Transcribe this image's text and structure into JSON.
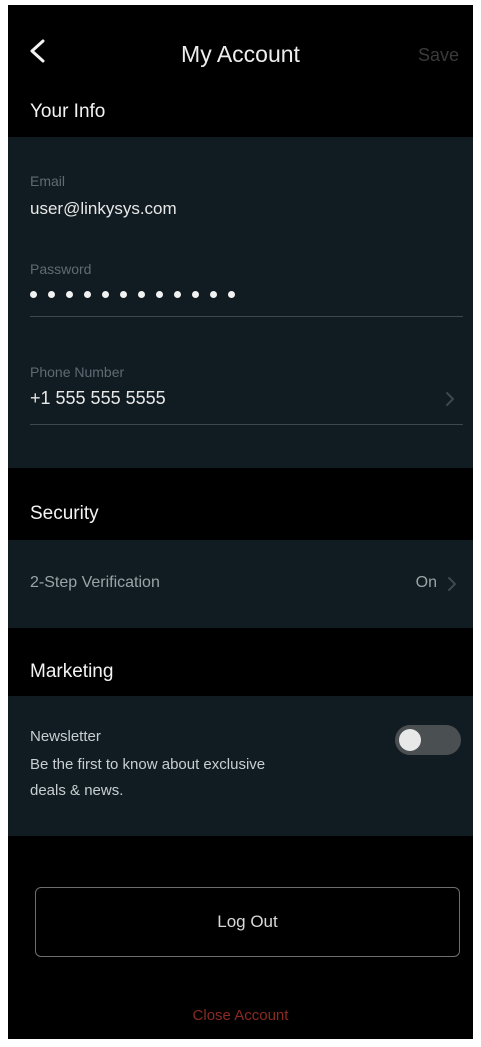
{
  "header": {
    "back_icon": "chevron-left-icon",
    "title": "My Account",
    "save_label": "Save"
  },
  "your_info": {
    "heading": "Your Info",
    "email_label": "Email",
    "email_value": "user@linkysys.com",
    "password_label": "Password",
    "password_mask": "••••••••••••",
    "phone_label": "Phone Number",
    "phone_value": "+1 555 555 5555"
  },
  "security": {
    "heading": "Security",
    "two_step_label": "2-Step Verification",
    "two_step_value": "On"
  },
  "marketing": {
    "heading": "Marketing",
    "newsletter_label": "Newsletter",
    "newsletter_desc_1": "Be the first to know about exclusive",
    "newsletter_desc_2": "deals & news.",
    "newsletter_enabled": false
  },
  "actions": {
    "logout_label": "Log Out",
    "close_account_label": "Close Account"
  },
  "colors": {
    "background": "#000000",
    "panel": "#111c22",
    "danger": "#8a2a22",
    "muted": "#5e6b72"
  }
}
